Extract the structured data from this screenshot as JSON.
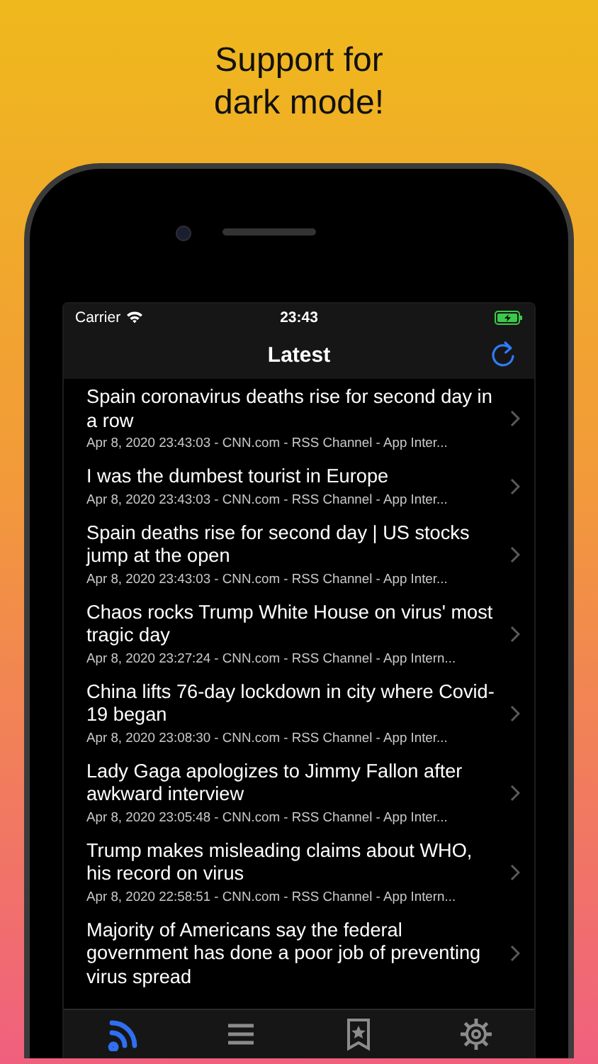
{
  "heading": "Support for dark mode!",
  "status_bar": {
    "carrier": "Carrier",
    "time": "23:43"
  },
  "nav": {
    "title": "Latest"
  },
  "articles": [
    {
      "title": "Spain coronavirus deaths rise for second day in a row",
      "meta": "Apr 8, 2020 23:43:03 - CNN.com - RSS Channel - App Inter..."
    },
    {
      "title": "I was the dumbest tourist in Europe",
      "meta": "Apr 8, 2020 23:43:03 - CNN.com - RSS Channel - App Inter..."
    },
    {
      "title": "Spain deaths rise for second day | US stocks jump at the open",
      "meta": "Apr 8, 2020 23:43:03 - CNN.com - RSS Channel - App Inter..."
    },
    {
      "title": "Chaos rocks Trump White House on virus' most tragic day",
      "meta": "Apr 8, 2020 23:27:24 - CNN.com - RSS Channel - App Intern..."
    },
    {
      "title": "China lifts 76-day lockdown in city where Covid-19 began",
      "meta": "Apr 8, 2020 23:08:30 - CNN.com - RSS Channel - App Inter..."
    },
    {
      "title": "Lady Gaga apologizes to Jimmy Fallon after awkward interview",
      "meta": "Apr 8, 2020 23:05:48 - CNN.com - RSS Channel - App Inter..."
    },
    {
      "title": "Trump makes misleading claims about WHO, his record on virus",
      "meta": "Apr 8, 2020 22:58:51 - CNN.com - RSS Channel - App Intern..."
    },
    {
      "title": "Majority of Americans say the federal government has done a poor job of preventing virus spread"
    }
  ],
  "tab_bar": {
    "tabs": [
      {
        "kind": "feed",
        "selected": true
      },
      {
        "kind": "list",
        "selected": false
      },
      {
        "kind": "starred",
        "selected": false
      },
      {
        "kind": "settings",
        "selected": false
      }
    ]
  }
}
